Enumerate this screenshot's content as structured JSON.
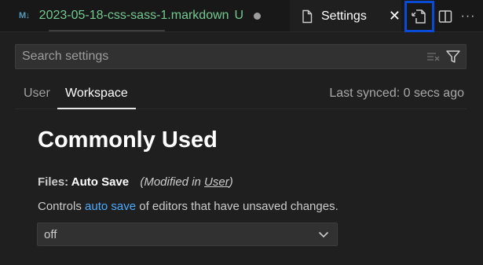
{
  "tabs": {
    "markdown": {
      "icon_text": "M↓",
      "title": "2023-05-18-css-sass-1.markdown",
      "status": "U"
    },
    "settings": {
      "title": "Settings",
      "close": "✕"
    }
  },
  "actions": {
    "more": "···"
  },
  "search": {
    "placeholder": "Search settings",
    "value": ""
  },
  "scope_tabs": {
    "user": "User",
    "workspace": "Workspace"
  },
  "last_synced": "Last synced: 0 secs ago",
  "section": {
    "title": "Commonly Used"
  },
  "setting": {
    "category": "Files: ",
    "name": "Auto Save",
    "modified_prefix": "(Modified in ",
    "modified_link": "User",
    "modified_suffix": ")",
    "desc_before": "Controls ",
    "desc_link": "auto save",
    "desc_after": " of editors that have unsaved changes.",
    "value": "off"
  },
  "colors": {
    "accent_link": "#4daafc",
    "highlight_border": "#0a4bd6",
    "git_untracked": "#73c991"
  }
}
